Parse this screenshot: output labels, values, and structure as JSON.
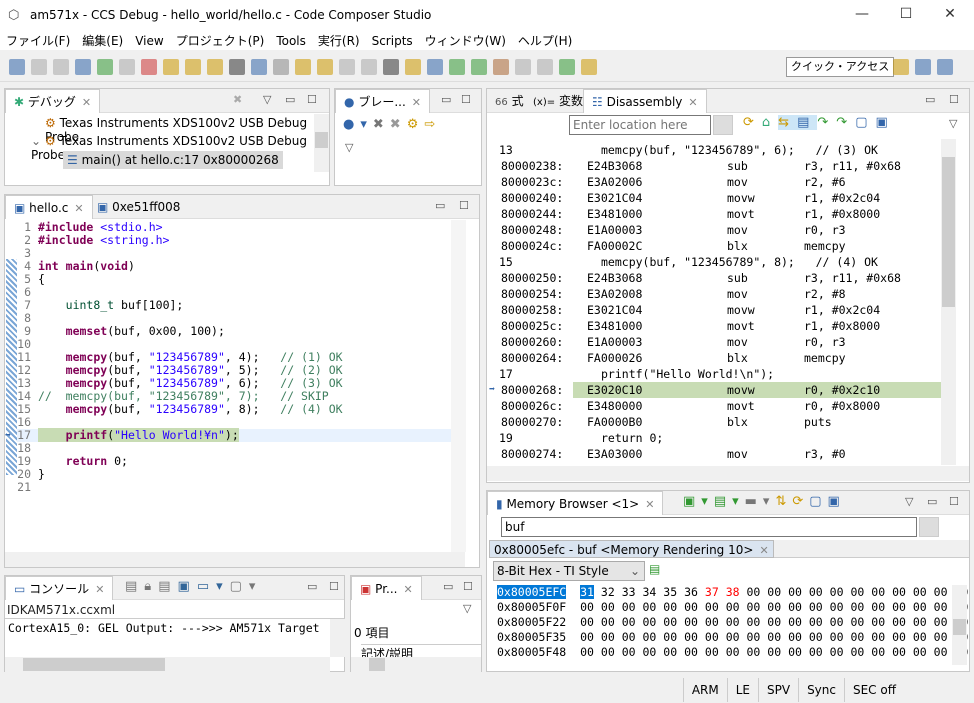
{
  "window": {
    "title": "am571x - CCS Debug - hello_world/hello.c - Code Composer Studio",
    "min": "—",
    "max": "☐",
    "close": "✕"
  },
  "menu": [
    "ファイル(F)",
    "編集(E)",
    "View",
    "プロジェクト(P)",
    "Tools",
    "実行(R)",
    "Scripts",
    "ウィンドウ(W)",
    "ヘルプ(H)"
  ],
  "toolbar": {
    "quick_access": "クイック・アクセス"
  },
  "debug": {
    "tab": "デバッグ",
    "items": [
      "Texas Instruments XDS100v2 USB Debug Probe",
      "Texas Instruments XDS100v2 USB Debug Probe",
      "main() at hello.c:17 0x80000268"
    ]
  },
  "breakpoints": {
    "tab": "ブレー..."
  },
  "editor": {
    "tabs": [
      "hello.c",
      "0xe51ff008"
    ],
    "current_line": 17,
    "lines": [
      [
        [
          "kw",
          "#include "
        ],
        [
          "str",
          "<stdio.h>"
        ]
      ],
      [
        [
          "kw",
          "#include "
        ],
        [
          "str",
          "<string.h>"
        ]
      ],
      [],
      [
        [
          "kw",
          "int "
        ],
        [
          "kw",
          "main"
        ],
        [
          "",
          "("
        ],
        [
          "kw",
          "void"
        ],
        [
          "",
          ")"
        ]
      ],
      [
        [
          "",
          "{"
        ]
      ],
      [],
      [
        [
          "",
          "    "
        ],
        [
          "ty",
          "uint8_t"
        ],
        [
          "",
          " buf[100];"
        ]
      ],
      [],
      [
        [
          "",
          "    "
        ],
        [
          "kw",
          "memset"
        ],
        [
          "",
          "(buf, 0x00, 100);"
        ]
      ],
      [],
      [
        [
          "",
          "    "
        ],
        [
          "kw",
          "memcpy"
        ],
        [
          "",
          "(buf, "
        ],
        [
          "str",
          "\"123456789\""
        ],
        [
          "",
          ", 4);   "
        ],
        [
          "cm",
          "// (1) OK"
        ]
      ],
      [
        [
          "",
          "    "
        ],
        [
          "kw",
          "memcpy"
        ],
        [
          "",
          "(buf, "
        ],
        [
          "str",
          "\"123456789\""
        ],
        [
          "",
          ", 5);   "
        ],
        [
          "cm",
          "// (2) OK"
        ]
      ],
      [
        [
          "",
          "    "
        ],
        [
          "kw",
          "memcpy"
        ],
        [
          "",
          "(buf, "
        ],
        [
          "str",
          "\"123456789\""
        ],
        [
          "",
          ", 6);   "
        ],
        [
          "cm",
          "// (3) OK"
        ]
      ],
      [
        [
          "cm",
          "//  memcpy(buf, \"123456789\", 7);   // SKIP"
        ]
      ],
      [
        [
          "",
          "    "
        ],
        [
          "kw",
          "memcpy"
        ],
        [
          "",
          "(buf, "
        ],
        [
          "str",
          "\"123456789\""
        ],
        [
          "",
          ", 8);   "
        ],
        [
          "cm",
          "// (4) OK"
        ]
      ],
      [],
      [
        [
          "",
          "    "
        ],
        [
          "kw",
          "printf"
        ],
        [
          "",
          "("
        ],
        [
          "str",
          "\"Hello World!¥n\""
        ],
        [
          "",
          ");"
        ]
      ],
      [],
      [
        [
          "",
          "    "
        ],
        [
          "kw",
          "return"
        ],
        [
          "",
          " 0;"
        ]
      ],
      [
        [
          "",
          "}"
        ]
      ],
      []
    ]
  },
  "expressions": {
    "tabs": [
      "式",
      "変数",
      "Disassembly"
    ],
    "location_placeholder": "Enter location here",
    "rows": [
      {
        "src": "13",
        "text": "memcpy(buf, \"123456789\", 6);   // (3) OK"
      },
      {
        "addr": "80000238:",
        "op": "E24B3068",
        "mn": "sub",
        "args": "r3, r11, #0x68"
      },
      {
        "addr": "8000023c:",
        "op": "E3A02006",
        "mn": "mov",
        "args": "r2, #6"
      },
      {
        "addr": "80000240:",
        "op": "E3021C04",
        "mn": "movw",
        "args": "r1, #0x2c04"
      },
      {
        "addr": "80000244:",
        "op": "E3481000",
        "mn": "movt",
        "args": "r1, #0x8000"
      },
      {
        "addr": "80000248:",
        "op": "E1A00003",
        "mn": "mov",
        "args": "r0, r3"
      },
      {
        "addr": "8000024c:",
        "op": "FA00002C",
        "mn": "blx",
        "args": "memcpy"
      },
      {
        "src": "15",
        "text": "memcpy(buf, \"123456789\", 8);   // (4) OK"
      },
      {
        "addr": "80000250:",
        "op": "E24B3068",
        "mn": "sub",
        "args": "r3, r11, #0x68"
      },
      {
        "addr": "80000254:",
        "op": "E3A02008",
        "mn": "mov",
        "args": "r2, #8"
      },
      {
        "addr": "80000258:",
        "op": "E3021C04",
        "mn": "movw",
        "args": "r1, #0x2c04"
      },
      {
        "addr": "8000025c:",
        "op": "E3481000",
        "mn": "movt",
        "args": "r1, #0x8000"
      },
      {
        "addr": "80000260:",
        "op": "E1A00003",
        "mn": "mov",
        "args": "r0, r3"
      },
      {
        "addr": "80000264:",
        "op": "FA000026",
        "mn": "blx",
        "args": "memcpy"
      },
      {
        "src": "17",
        "text": "printf(\"Hello World!\\n\");"
      },
      {
        "addr": "80000268:",
        "op": "E3020C10",
        "mn": "movw",
        "args": "r0, #0x2c10",
        "current": true
      },
      {
        "addr": "8000026c:",
        "op": "E3480000",
        "mn": "movt",
        "args": "r0, #0x8000"
      },
      {
        "addr": "80000270:",
        "op": "FA0000B0",
        "mn": "blx",
        "args": "puts"
      },
      {
        "src": "19",
        "text": "return 0;"
      },
      {
        "addr": "80000274:",
        "op": "E3A03000",
        "mn": "mov",
        "args": "r3, #0"
      }
    ]
  },
  "memory": {
    "tab": "Memory Browser <1>",
    "address_input": "buf",
    "rendering_tab": "0x80005efc - buf <Memory Rendering 10>",
    "format": "8-Bit Hex - TI Style",
    "rows": [
      {
        "addr": "0x80005EFC",
        "bytes": [
          "31",
          "32",
          "33",
          "34",
          "35",
          "36",
          "37",
          "38",
          "00",
          "00",
          "00",
          "00",
          "00",
          "00",
          "00",
          "00",
          "00",
          "00",
          "00"
        ]
      },
      {
        "addr": "0x80005F0F",
        "bytes": [
          "00",
          "00",
          "00",
          "00",
          "00",
          "00",
          "00",
          "00",
          "00",
          "00",
          "00",
          "00",
          "00",
          "00",
          "00",
          "00",
          "00",
          "00",
          "00"
        ]
      },
      {
        "addr": "0x80005F22",
        "bytes": [
          "00",
          "00",
          "00",
          "00",
          "00",
          "00",
          "00",
          "00",
          "00",
          "00",
          "00",
          "00",
          "00",
          "00",
          "00",
          "00",
          "00",
          "00",
          "00"
        ]
      },
      {
        "addr": "0x80005F35",
        "bytes": [
          "00",
          "00",
          "00",
          "00",
          "00",
          "00",
          "00",
          "00",
          "00",
          "00",
          "00",
          "00",
          "00",
          "00",
          "00",
          "00",
          "00",
          "00",
          "00"
        ]
      },
      {
        "addr": "0x80005F48",
        "bytes": [
          "00",
          "00",
          "00",
          "00",
          "00",
          "00",
          "00",
          "00",
          "00",
          "00",
          "00",
          "00",
          "00",
          "00",
          "00",
          "00",
          "00",
          "00",
          "00"
        ]
      }
    ],
    "changed_color": "#ff0000",
    "changed_indices": [
      6,
      7
    ],
    "selected_color": "#0078d7"
  },
  "console": {
    "tab": "コンソール",
    "source": "IDKAM571x.ccxml",
    "output": "CortexA15_0: GEL Output: --->>> AM571x Target"
  },
  "problems": {
    "tab": "Pr...",
    "count": "0 項目",
    "column": "記述/説明"
  },
  "statusbar": [
    "ARM",
    "LE",
    "SPV",
    "Sync",
    "SEC off"
  ]
}
